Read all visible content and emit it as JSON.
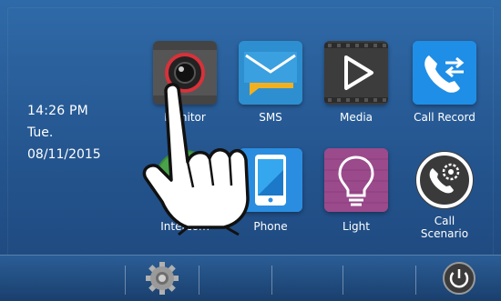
{
  "status": {
    "time": "14:26  PM",
    "weekday": "Tue.",
    "date": "08/11/2015"
  },
  "apps": [
    {
      "label": "Monitor",
      "icon": "camera-icon"
    },
    {
      "label": "SMS",
      "icon": "envelope-icon"
    },
    {
      "label": "Media",
      "icon": "play-icon"
    },
    {
      "label": "Call Record",
      "icon": "call-record-icon"
    },
    {
      "label": "Intercom",
      "icon": "intercom-icon"
    },
    {
      "label": "Phone",
      "icon": "phone-icon"
    },
    {
      "label": "Light",
      "icon": "lightbulb-icon"
    },
    {
      "label": "Call Scenario",
      "label_line1": "Call",
      "label_line2": "Scenario",
      "icon": "call-scenario-icon"
    }
  ],
  "bottom_bar": {
    "settings_icon": "gear-icon",
    "power_icon": "power-icon"
  },
  "overlay": {
    "icon": "tap-hand-icon"
  },
  "colors": {
    "background": "#2a5f9c",
    "bar": "#1f4a7c",
    "accent_red": "#d8313a",
    "sms_blue": "#2d8fd0",
    "phone_blue": "#2b8de0",
    "light_purple": "#9b4a8c",
    "call_record_blue": "#1f8ee6"
  }
}
